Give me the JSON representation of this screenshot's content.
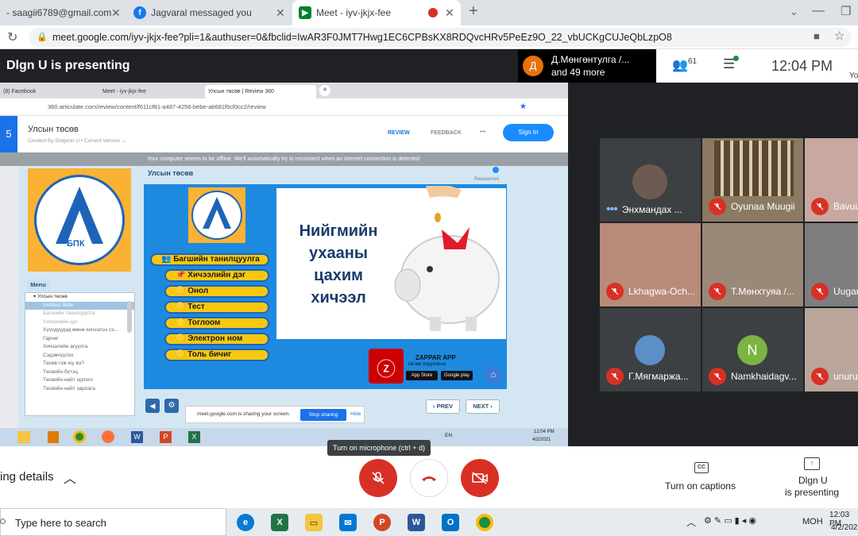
{
  "browser": {
    "tabs": [
      {
        "label": "- saagii6789@gmail.com -",
        "icon": "gmail-icon"
      },
      {
        "label": "Jagvaral messaged you",
        "icon": "facebook-icon"
      },
      {
        "label": "Meet - iyv-jkjx-fee",
        "icon": "meet-icon"
      }
    ],
    "new_tab": "+",
    "url": "meet.google.com/iyv-jkjx-fee?pli=1&authuser=0&fbclid=IwAR3F0JMT7Hwg1EC6CPBsKX8RDQvcHRv5PeEz9O_22_vbUCKgCUJeQbLzpO8"
  },
  "meet_header": {
    "presenting": "Dlgn U is presenting",
    "notification_name": "Д.Мөнгөнтулга /...",
    "notification_more": "and 49 more",
    "participant_count": "61",
    "time": "12:04 PM",
    "you_label": "Yo"
  },
  "shared_screen": {
    "tabs": [
      "(8) Facebook",
      "Meet - iyv-jkjx-fee",
      "Улсын төсөв | Review 360"
    ],
    "url": "360.articulate.com/review/content/f611cf81-a487-4256-bebe-ab681f6cf0cc2/review",
    "course_title": "Улсын төсөв",
    "created_by": "Created By Dolgoon U  •  Current Version ⌄",
    "nav_review": "REVIEW",
    "nav_feedback": "FEEDBACK",
    "nav_more": "•••",
    "sign_in": "Sign In",
    "offline_msg": "Your computer seems to be offline. We'll automatically try to reconnect when an internet connection is detected.",
    "slide_header": "Улсын төсөв",
    "resources": "Resources",
    "menu_title": "Menu",
    "menu_items": [
      "▾ Улсын төсөв",
      "Untitled Slide",
      "Багшийн танилцуулга",
      "Хичээлийн дэг",
      "Хүүхдүүдэд өмнө хичээлээ сэ...",
      "Гарчиг",
      "Хичээлийн агуулга",
      "Сэдэвчүүлэх",
      "Төсөв гэж юу вэ?",
      "Төсвийн бүтэц",
      "Төсвийн нийт орлого",
      "Төсвийн нийт зарлага"
    ],
    "logo_text": "БПК",
    "pill_buttons": [
      "👥 Багшийн танилцуулга",
      "📌 Хичээлийн дэг",
      "🟡 Онол",
      "🟡 Тест",
      "⭐ Тоглоом",
      "🟡 Электрон ном",
      "🟡 Толь бичиг"
    ],
    "slide_lines": [
      "Нийгмийн",
      "ухааны",
      "цахим",
      "хичээл"
    ],
    "zappar_title": "ZAPPAR APP",
    "zappar_sub": "татаж үзүүлэгнэ",
    "app_store": "App Store",
    "google_play": "Google play",
    "prev": "‹ PREV",
    "next": "NEXT ›",
    "sharing_msg": "meet.google.com is sharing your screen.",
    "stop_sharing": "Stop sharing",
    "hide": "Hide",
    "tray_lang": "EN",
    "tray_time": "12:04 PM",
    "tray_date": "4/2/2021"
  },
  "participants": [
    {
      "name": "Энхмандах ...",
      "muted": false
    },
    {
      "name": "Oyunaa Muugii",
      "muted": true
    },
    {
      "name": "Bavuu",
      "muted": true
    },
    {
      "name": "Lkhagwa-Och...",
      "muted": true
    },
    {
      "name": "Т.Мөнхтуяа /...",
      "muted": true
    },
    {
      "name": "Uuganaa",
      "muted": true
    },
    {
      "name": "Г.Мягмаржа...",
      "muted": true
    },
    {
      "name": "Namkhaidagv...",
      "muted": true,
      "initial": "N"
    },
    {
      "name": "unurus",
      "muted": true
    }
  ],
  "bottom": {
    "meeting_details": "ing details",
    "tooltip": "Turn on microphone (ctrl + d)",
    "captions": "Turn on captions",
    "presenting_line1": "Dlgn U",
    "presenting_line2": "is presenting",
    "cc": "CC"
  },
  "taskbar": {
    "search_placeholder": "Type here to search",
    "lang": "МОН",
    "time": "12:03 PM",
    "date": "4/2/2021"
  }
}
